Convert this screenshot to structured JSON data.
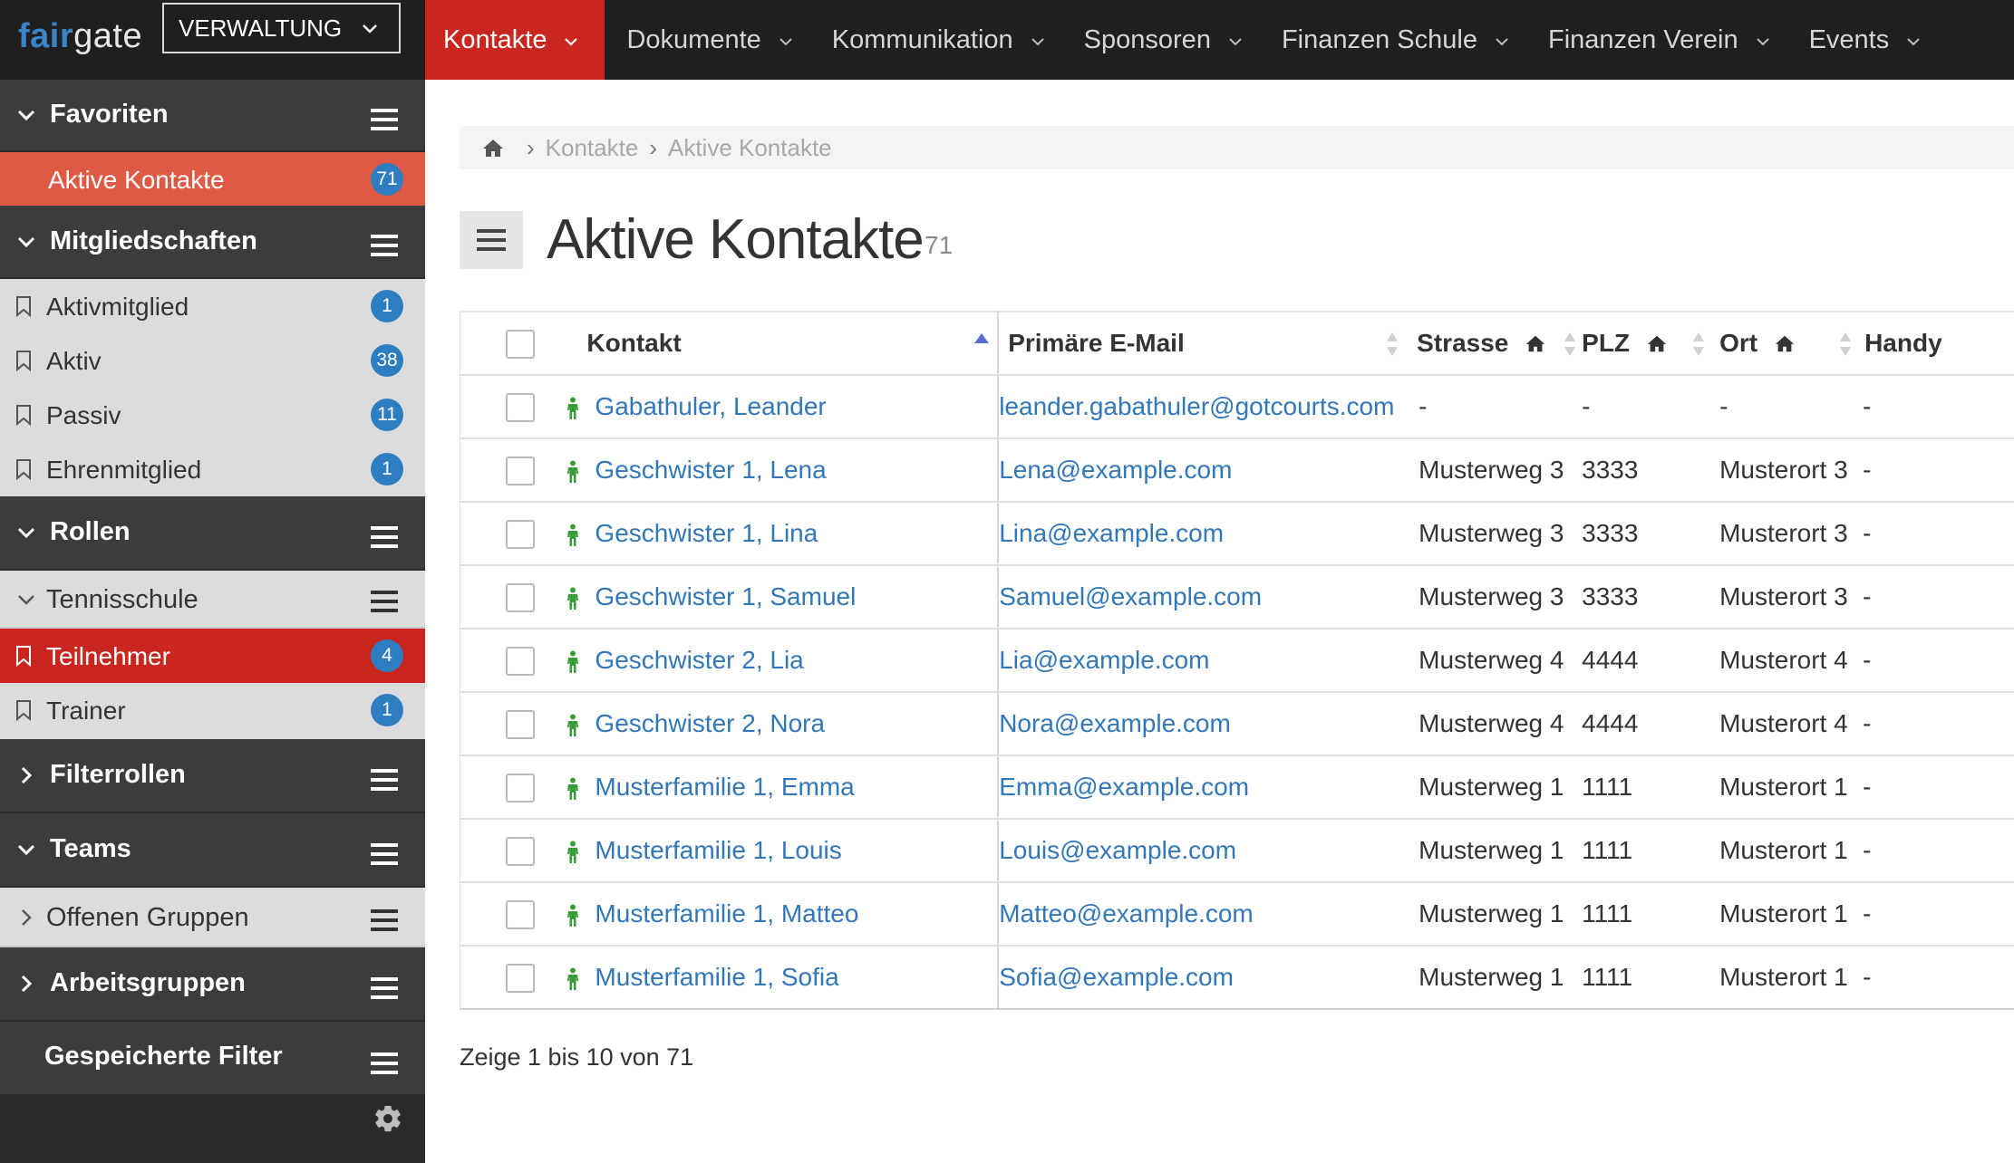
{
  "brand": {
    "part1": "fair",
    "part2": "gate"
  },
  "module_select": {
    "value": "VERWALTUNG"
  },
  "nav": [
    {
      "label": "Kontakte"
    },
    {
      "label": "Dokumente"
    },
    {
      "label": "Kommunikation"
    },
    {
      "label": "Sponsoren"
    },
    {
      "label": "Finanzen Schule"
    },
    {
      "label": "Finanzen Verein"
    },
    {
      "label": "Events"
    }
  ],
  "sidebar": {
    "favoriten": "Favoriten",
    "fav_items": [
      {
        "label": "Aktive Kontakte",
        "count": "71"
      }
    ],
    "mitgliedschaften": "Mitgliedschaften",
    "membership_items": [
      {
        "label": "Aktivmitglied",
        "count": "1"
      },
      {
        "label": "Aktiv",
        "count": "38"
      },
      {
        "label": "Passiv",
        "count": "11"
      },
      {
        "label": "Ehrenmitglied",
        "count": "1"
      }
    ],
    "rollen": "Rollen",
    "tennisschule": "Tennisschule",
    "role_items": [
      {
        "label": "Teilnehmer",
        "count": "4"
      },
      {
        "label": "Trainer",
        "count": "1"
      }
    ],
    "filterrollen": "Filterrollen",
    "teams": "Teams",
    "offenen_gruppen": "Offenen Gruppen",
    "arbeitsgruppen": "Arbeitsgruppen",
    "gespeicherte_filter": "Gespeicherte Filter"
  },
  "breadcrumb": [
    "Kontakte",
    "Aktive Kontakte"
  ],
  "page": {
    "title": "Aktive Kontakte",
    "count": "71"
  },
  "table": {
    "headers": {
      "kontakt": "Kontakt",
      "email": "Primäre E-Mail",
      "strasse": "Strasse",
      "plz": "PLZ",
      "ort": "Ort",
      "handy": "Handy"
    },
    "rows": [
      {
        "name": "Gabathuler, Leander",
        "email": "leander.gabathuler@gotcourts.com",
        "strasse": "-",
        "plz": "-",
        "ort": "-",
        "handy": "-"
      },
      {
        "name": "Geschwister 1, Lena",
        "email": "Lena@example.com",
        "strasse": "Musterweg 3",
        "plz": "3333",
        "ort": "Musterort 3",
        "handy": "-"
      },
      {
        "name": "Geschwister 1, Lina",
        "email": "Lina@example.com",
        "strasse": "Musterweg 3",
        "plz": "3333",
        "ort": "Musterort 3",
        "handy": "-"
      },
      {
        "name": "Geschwister 1, Samuel",
        "email": "Samuel@example.com",
        "strasse": "Musterweg 3",
        "plz": "3333",
        "ort": "Musterort 3",
        "handy": "-"
      },
      {
        "name": "Geschwister 2, Lia",
        "email": "Lia@example.com",
        "strasse": "Musterweg 4",
        "plz": "4444",
        "ort": "Musterort 4",
        "handy": "-"
      },
      {
        "name": "Geschwister 2, Nora",
        "email": "Nora@example.com",
        "strasse": "Musterweg 4",
        "plz": "4444",
        "ort": "Musterort 4",
        "handy": "-"
      },
      {
        "name": "Musterfamilie 1, Emma",
        "email": "Emma@example.com",
        "strasse": "Musterweg 1",
        "plz": "1111",
        "ort": "Musterort 1",
        "handy": "-"
      },
      {
        "name": "Musterfamilie 1, Louis",
        "email": "Louis@example.com",
        "strasse": "Musterweg 1",
        "plz": "1111",
        "ort": "Musterort 1",
        "handy": "-"
      },
      {
        "name": "Musterfamilie 1, Matteo",
        "email": "Matteo@example.com",
        "strasse": "Musterweg 1",
        "plz": "1111",
        "ort": "Musterort 1",
        "handy": "-"
      },
      {
        "name": "Musterfamilie 1, Sofia",
        "email": "Sofia@example.com",
        "strasse": "Musterweg 1",
        "plz": "1111",
        "ort": "Musterort 1",
        "handy": "-"
      }
    ]
  },
  "footer": {
    "info": "Zeige 1 bis 10 von 71"
  },
  "icons": {
    "menu": "hamburger-menu-icon",
    "chevron": "chevron-down-icon",
    "bookmark": "bookmark-icon",
    "person": "person-icon",
    "home": "home-icon",
    "gear": "gear-icon"
  },
  "colors": {
    "accent_red": "#c9261f",
    "favorite_orange": "#de5a44",
    "badge_blue": "#2e7dc0",
    "link_blue": "#3277b8",
    "person_green": "#3a9b3a",
    "topbar": "#1f1f1f",
    "sidebar_section": "#3c3c3c",
    "sidebar_item": "#dcdcdc"
  }
}
